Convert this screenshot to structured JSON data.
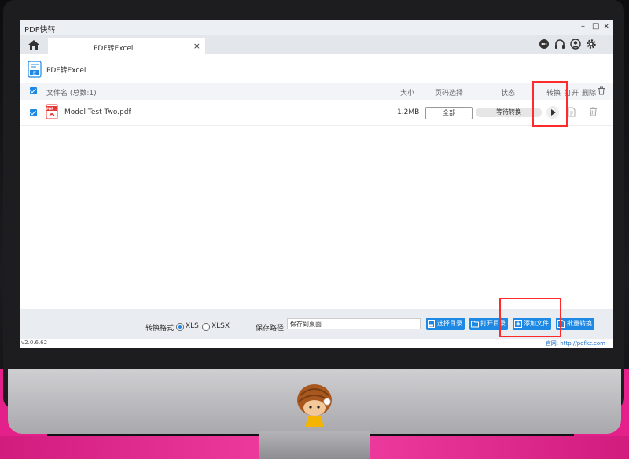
{
  "window": {
    "title": "PDF快转",
    "minimize": "–",
    "maximize": "□",
    "close": "×"
  },
  "tabs": [
    {
      "label": "PDF转Excel",
      "close": "×"
    }
  ],
  "header": {
    "label": "PDF转Excel"
  },
  "columns": {
    "filename": "文件名 (总数:1)",
    "size": "大小",
    "page_select": "页码选择",
    "status": "状态",
    "convert": "转换",
    "open": "打开",
    "delete": "删除"
  },
  "files": [
    {
      "name": "Model Test Two.pdf",
      "size": "1.2MB",
      "page_select": "全部",
      "status": "等待转换",
      "file_type": "PDF"
    }
  ],
  "footer": {
    "format_label": "转换格式:",
    "format_options": [
      "XLS",
      "XLSX"
    ],
    "selected_format": "XLS",
    "save_path_label": "保存路径:",
    "save_path_value": "保存到桌面",
    "buttons": {
      "choose_dir": "选择目录",
      "open_dir": "打开目录",
      "add_file": "添加文件",
      "batch_convert": "批量转换"
    }
  },
  "statusbar": {
    "version": "v2.0.6.62",
    "website": "官网: http://pdfkz.com"
  },
  "colors": {
    "accent": "#1e88e5",
    "highlight": "#ff2a2a",
    "background_pink": "#e4208a"
  }
}
